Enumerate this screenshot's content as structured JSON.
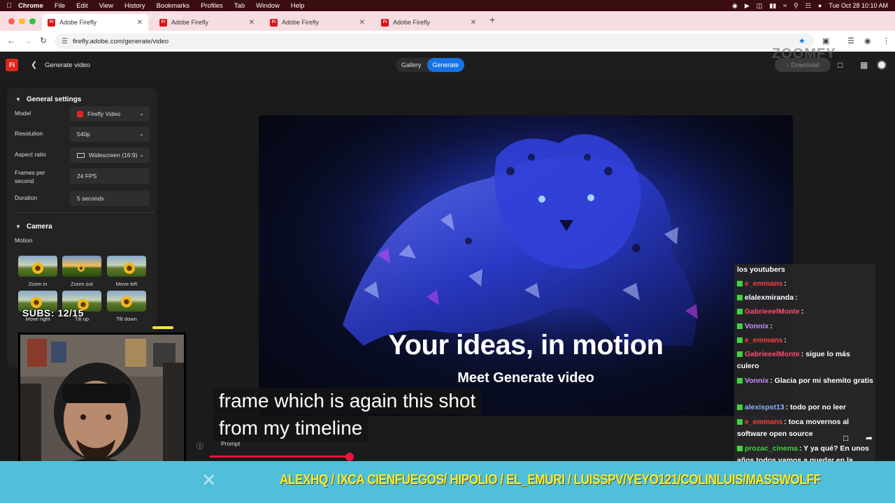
{
  "menubar": {
    "app": "Chrome",
    "items": [
      "File",
      "Edit",
      "View",
      "History",
      "Bookmarks",
      "Profiles",
      "Tab",
      "Window",
      "Help"
    ],
    "clock": "Tue Oct 28  10:10 AM"
  },
  "browser": {
    "overlay_title": "#AdobeMAX 2025 Opening Keynote | Adobe",
    "tabs": [
      {
        "label": "Adobe Firefly"
      },
      {
        "label": "Adobe Firefly"
      },
      {
        "label": "Adobe Firefly"
      },
      {
        "label": "Adobe Firefly"
      }
    ],
    "url": "firefly.adobe.com/generate/video",
    "new_tab": "+"
  },
  "app_header": {
    "logo": "Fi",
    "page_title": "Generate video",
    "gallery_label": "Gallery",
    "generate_label": "Generate",
    "download_label": "Download",
    "watermark": "ZOOMFY"
  },
  "general_settings": {
    "title": "General settings",
    "model_label": "Model",
    "model_value": "Firefly Video",
    "resolution_label": "Resolution",
    "resolution_value": "540p",
    "aspect_label": "Aspect ratio",
    "aspect_value": "Widescreen (16:9)",
    "fps_label": "Frames per second",
    "fps_value": "24 FPS",
    "duration_label": "Duration",
    "duration_value": "5 seconds"
  },
  "camera": {
    "title": "Camera",
    "motion_label": "Motion",
    "options": [
      "Zoom in",
      "Zoom out",
      "Move left",
      "Move right",
      "Tilt up",
      "Tilt down"
    ]
  },
  "stream": {
    "subs_counter": "SUBS: 12/15",
    "caption_line1": "frame which is again this shot",
    "caption_line2": "from my timeline",
    "banner": "ALEXHQ / IXCA CIENFUEGOS/ HIPOLIO / EL_EMURI / LUISSPV/YEYO121/COLINLUIS/MASSWOLFF"
  },
  "video": {
    "headline": "Your ideas, in motion",
    "subhead": "Meet Generate video"
  },
  "prompt": {
    "label": "Prompt"
  },
  "chat": {
    "messages": [
      {
        "user": "",
        "text": "los youtubers",
        "color": "#ffffff"
      },
      {
        "user": "e_emmans",
        "text": ":",
        "color": "#ff3d3d"
      },
      {
        "user": "elalexmiranda",
        "text": ":",
        "color": "#ffffff"
      },
      {
        "user": "GabrieeelMonte",
        "text": ":",
        "color": "#ff4d6a"
      },
      {
        "user": "Vonnix",
        "text": ":",
        "color": "#c58cff"
      },
      {
        "user": "e_emmans",
        "text": ":",
        "color": "#ff3d3d"
      },
      {
        "user": "GabrieeelMonte",
        "text": ": sigue lo más culero",
        "color": "#ff4d6a"
      },
      {
        "user": "Vonnix",
        "text": ": Glacia por mi shemito gratis",
        "color": "#c58cff"
      },
      {
        "user": "alexispst13",
        "text": ": todo por no leer",
        "color": "#8ab4ff"
      },
      {
        "user": "e_emmans",
        "text": ": toca movernos al software open source",
        "color": "#ff3d3d"
      },
      {
        "user": "prozac_cinema",
        "text": ": Y ya qué? En unos años todos vamos a quedar en la intrascendencia",
        "color": "#3fd43f"
      }
    ]
  },
  "colors": {
    "accent": "#1473e6",
    "brand": "#e1251b",
    "banner_bg": "#50bfd9",
    "banner_text": "#f7ec2a"
  }
}
